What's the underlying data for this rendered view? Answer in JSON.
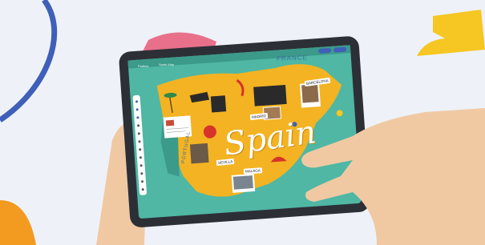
{
  "map": {
    "title": "Spain",
    "france": "FRANCE",
    "portugal": "PORTUGAL",
    "cities": {
      "barcelona": "BARCELONA",
      "madrid": "MADRID",
      "sevilla": "SEVILLA",
      "malaga": "MALAGA"
    }
  },
  "app": {
    "back_label": "Padlets",
    "board_label": "Spain Map"
  },
  "colors": {
    "background": "#eef2f8",
    "tablet_frame": "#2d2f36",
    "sea": "#4fb7a4",
    "land": "#f3b323",
    "shape_yellow": "#f6c622",
    "shape_blue": "#3f5fb8",
    "shape_pink": "#e8708b",
    "skin": "#f0c9a3"
  }
}
